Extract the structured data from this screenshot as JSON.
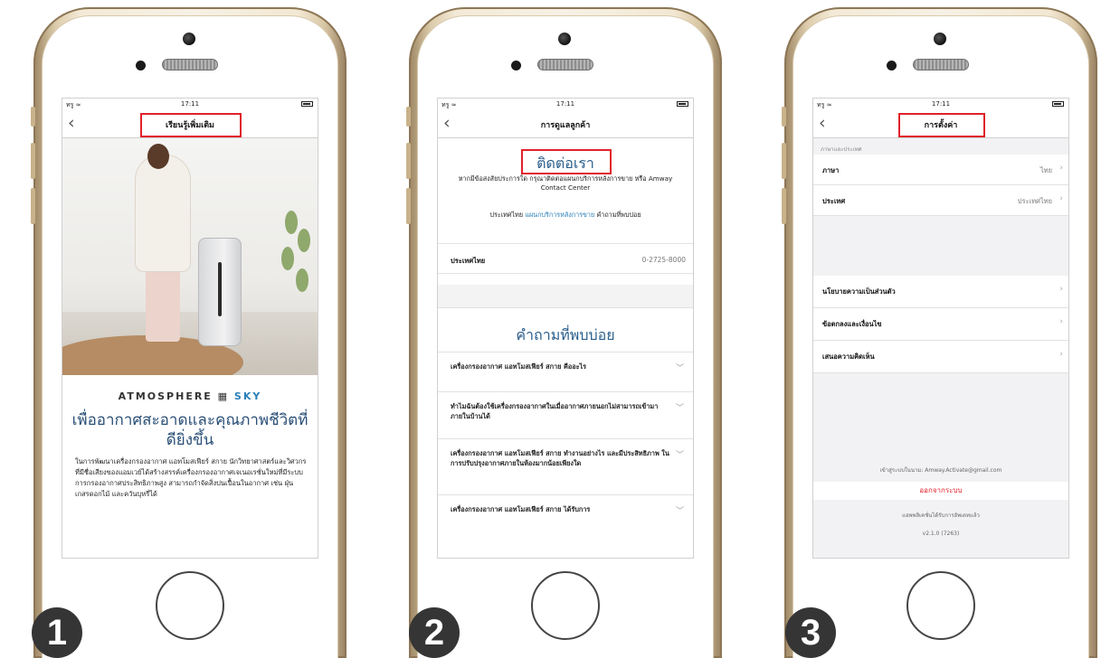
{
  "status_bar": {
    "carrier": "ทรู ≈",
    "time": "17:11"
  },
  "screen1": {
    "nav_title": "เรียนรู้เพิ่มเติม",
    "brand_left": "ATMOSPHERE",
    "brand_right": "SKY",
    "headline": "เพื่ออากาศสะอาดและคุณภาพชีวิตที่ดียิ่งขึ้น",
    "body": "ในการพัฒนาเครื่องกรองอากาศ แอทโมสเฟียร์ สกาย นักวิทยาศาสตร์และวิศวกรที่มีชื่อเสียงของแอมเวย์ได้สร้างสรรค์เครื่องกรองอากาศเจเนอเรชั่นใหม่ที่มีระบบการกรองอากาศประสิทธิภาพสูง สามารถกำจัดสิ่งปนเปื้อนในอากาศ เช่น ฝุ่น เกสรดอกไม้ และควันบุหรี่ได้"
  },
  "screen2": {
    "nav_title": "การดูแลลูกค้า",
    "contact_title": "ติดต่อเรา",
    "contact_text": "หากมีข้อสงสัยประการใด กรุณาติดต่อแผนกบริการหลังการขาย หรือ Amway Contact Center",
    "contact_text2_prefix": "ประเทศไทย",
    "contact_link": "แผนกบริการหลังการขาย",
    "contact_text2_suffix": "คำถามที่พบบ่อย",
    "phone_label": "ประเทศไทย",
    "phone_value": "0-2725-8000",
    "faq_title": "คำถามที่พบบ่อย",
    "faqs": [
      "เครื่องกรองอากาศ แอทโมสเฟียร์ สกาย คืออะไร",
      "ทำไมฉันต้องใช้เครื่องกรองอากาศในเมื่ออากาศภายนอกไม่สามารถเข้ามาภายในบ้านได้",
      "เครื่องกรองอากาศ แอทโมสเฟียร์ สกาย ทำงานอย่างไร และมีประสิทธิภาพ ในการปรับปรุงอากาศภายในห้องมากน้อยเพียงใด",
      "เครื่องกรองอากาศ แอทโมสเฟียร์ สกาย ได้รับการ"
    ]
  },
  "screen3": {
    "nav_title": "การตั้งค่า",
    "group_header": "ภาษาและประเทศ",
    "rows_group1": [
      {
        "label": "ภาษา",
        "value": "ไทย"
      },
      {
        "label": "ประเทศ",
        "value": "ประเทศไทย"
      }
    ],
    "rows_group2": [
      {
        "label": "นโยบายความเป็นส่วนตัว"
      },
      {
        "label": "ข้อตกลงและเงื่อนไข"
      },
      {
        "label": "เสนอความคิดเห็น"
      }
    ],
    "signed_in_as": "เข้าสู่ระบบในนาม: Amway.Activate@gmail.com",
    "logout": "ออกจากระบบ",
    "footer_note": "แอพพลิเคชั่นได้รับการอัพเดทแล้ว",
    "version": "v2.1.0 (7263)"
  },
  "step_badges": [
    "1",
    "2",
    "3"
  ],
  "colors": {
    "highlight": "#e0212a",
    "heading_blue": "#2a5e8c",
    "link_blue": "#2a7fb8",
    "badge": "#353535"
  }
}
